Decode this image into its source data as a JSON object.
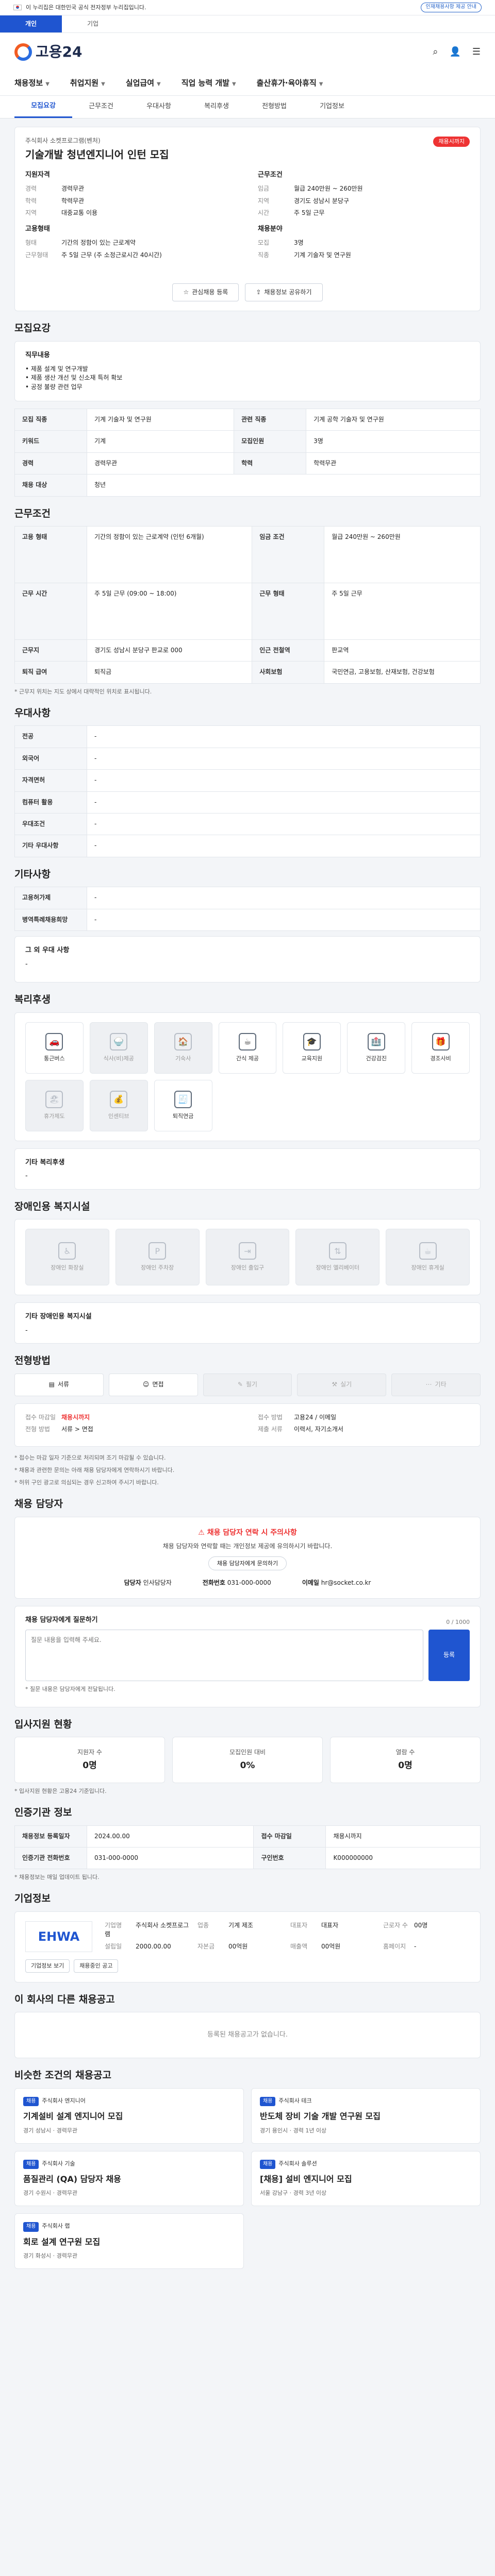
{
  "gov": {
    "text": "이 누리집은 대한민국 공식 전자정부 누리집입니다.",
    "chip": "인재채용사항 제공 안내"
  },
  "tabs": [
    "개인",
    "기업"
  ],
  "logo": "고용24",
  "gnb": [
    "채용정보",
    "취업지원",
    "실업급여",
    "직업 능력 개발",
    "출산휴가·육아휴직"
  ],
  "subtabs": [
    "모집요강",
    "근무조건",
    "우대사항",
    "복리후생",
    "전형방법",
    "기업정보"
  ],
  "job": {
    "company": "주식회사 소켓프로그램(벤처)",
    "title": "기술개발 청년엔지니어 인턴 모집",
    "dday": "채용시까지",
    "left_h": "지원자격",
    "right_h": "근무조건",
    "left": [
      [
        "경력",
        "경력무관"
      ],
      [
        "학력",
        "학력무관"
      ],
      [
        "지역",
        "대중교통 이용"
      ]
    ],
    "right": [
      [
        "임금",
        "월급 240만원 ~ 260만원"
      ],
      [
        "지역",
        "경기도 성남시 분당구"
      ],
      [
        "시간",
        "주 5일 근무"
      ]
    ],
    "left2_h": "고용형태",
    "right2_h": "채용분야",
    "left2": [
      [
        "형태",
        "기간의 정함이 있는 근로계약"
      ],
      [
        "근무형태",
        "주 5일 근무 (주 소정근로시간 40시간)"
      ]
    ],
    "right2": [
      [
        "모집",
        "3명"
      ],
      [
        "직종",
        "기계 기술자 및 연구원"
      ]
    ],
    "btn_save": "관심채용 등록",
    "btn_share": "채용정보 공유하기"
  },
  "recruit": {
    "title": "모집요강",
    "desc_h": "직무내용",
    "desc": "• 제품 설계 및 연구개발\n• 제품 생산 개선 및 신소재 특허 확보\n• 공정 불량 관련 업무",
    "rows": [
      [
        "모집 직종",
        "기계 기술자 및 연구원"
      ],
      [
        "관련 직종",
        "기계 공학 기술자 및 연구원"
      ],
      [
        "키워드",
        "기계"
      ],
      [
        "모집인원",
        "3명"
      ],
      [
        "경력",
        "경력무관"
      ],
      [
        "학력",
        "학력무관"
      ]
    ],
    "extra": [
      "채용 대상",
      "청년"
    ]
  },
  "work": {
    "title": "근무조건",
    "rows": [
      [
        "고용 형태",
        "기간의 정함이 있는 근로계약 (인턴 6개월)",
        "임금 조건",
        "월급 240만원 ~ 260만원"
      ],
      [
        "근무 시간",
        "주 5일 근무 (09:00 ~ 18:00)",
        "근무 형태",
        "주 5일 근무"
      ],
      [
        "근무지",
        "경기도 성남시 분당구 판교로 000",
        "인근 전철역",
        "판교역"
      ],
      [
        "퇴직 급여",
        "퇴직금",
        "사회보험",
        "국민연금, 고용보험, 산재보험, 건강보험"
      ]
    ],
    "note": "* 근무지 위치는 지도 상에서 대략적인 위치로 표시됩니다."
  },
  "pref": {
    "title": "우대사항",
    "rows": [
      [
        "전공",
        "-"
      ],
      [
        "외국어",
        "-"
      ],
      [
        "자격면허",
        "-"
      ],
      [
        "컴퓨터 활용",
        "-"
      ],
      [
        "우대조건",
        "-"
      ],
      [
        "기타 우대사항",
        "-"
      ]
    ]
  },
  "other": {
    "title": "기타사항",
    "rows": [
      [
        "고용허가제",
        "-"
      ],
      [
        "병역특례채용희망",
        "-"
      ]
    ],
    "detail_h": "그 외 우대 사항",
    "detail": "-"
  },
  "welfare": {
    "title": "복리후생",
    "items": [
      [
        "🚗",
        "통근버스"
      ],
      [
        "🍚",
        "식사(비)제공"
      ],
      [
        "🏠",
        "기숙사"
      ],
      [
        "☕",
        "간식 제공"
      ],
      [
        "🎓",
        "교육지원"
      ],
      [
        "🏥",
        "건강검진"
      ],
      [
        "🎁",
        "경조사비"
      ],
      [
        "🏖",
        "휴가제도"
      ],
      [
        "💰",
        "인센티브"
      ],
      [
        "🧾",
        "퇴직연금"
      ]
    ],
    "other_h": "기타 복리후생",
    "other": "-"
  },
  "disabled": {
    "title": "장애인용 복지시설",
    "items": [
      "장애인 화장실",
      "장애인 주차장",
      "장애인 출입구",
      "장애인 엘리베이터",
      "장애인 휴게실"
    ],
    "other_h": "기타 장애인용 복지시설",
    "other": "-"
  },
  "apply": {
    "title": "전형방법",
    "methods": [
      "서류",
      "면접",
      "필기",
      "실기",
      "기타"
    ],
    "left": [
      [
        "접수 마감일",
        "채용시까지"
      ],
      [
        "전형 방법",
        "서류 > 면접"
      ]
    ],
    "right": [
      [
        "접수 방법",
        "고용24 / 이메일"
      ],
      [
        "제출 서류",
        "이력서, 자기소개서"
      ]
    ],
    "notes": [
      "* 접수는 마감 일자 기준으로 처리되며 조기 마감될 수 있습니다.",
      "* 채용과 관련한 문의는 아래 채용 담당자에게 연락하시기 바랍니다.",
      "* 허위 구인 광고로 의심되는 경우 신고하여 주시기 바랍니다."
    ]
  },
  "contact": {
    "title": "채용 담당자",
    "warn": "채용 담당자 연락 시 주의사항",
    "text": "채용 담당자와 연락할 때는 개인정보 제공에 유의하시기 바랍니다.",
    "pill": "채용 담당자에게 문의하기",
    "labels": [
      "담당자",
      "전화번호",
      "이메일"
    ],
    "values": [
      "인사담당자",
      "031-000-0000",
      "hr@socket.co.kr"
    ]
  },
  "inquiry": {
    "title": "채용 담당자에게 질문하기",
    "placeholder": "질문 내용을 입력해 주세요.",
    "btn": "등록",
    "counter": "0 / 1000",
    "notes": [
      "* 질문 내용은 담당자에게 전달됩니다."
    ]
  },
  "applicants": {
    "title": "입사지원 현황",
    "stats": [
      [
        "지원자 수",
        "0명"
      ],
      [
        "모집인원 대비",
        "0%"
      ],
      [
        "열람 수",
        "0명"
      ]
    ],
    "note": "* 입사지원 현황은 고용24 기준입니다."
  },
  "reg": {
    "title": "인증기관 정보",
    "rows": [
      [
        "채용정보 등록일자",
        "2024.00.00",
        "접수 마감일",
        "채용시까지"
      ],
      [
        "인증기관 전화번호",
        "031-000-0000",
        "구인번호",
        "K000000000"
      ]
    ],
    "note": "* 채용정보는 매일 업데이트 됩니다."
  },
  "company": {
    "title": "기업정보",
    "logo": "EHWA",
    "rows": [
      [
        "기업명",
        "주식회사 소켓프로그램"
      ],
      [
        "업종",
        "기계 제조"
      ],
      [
        "대표자",
        "대표자"
      ],
      [
        "근로자 수",
        "00명"
      ],
      [
        "설립일",
        "2000.00.00"
      ],
      [
        "자본금",
        "00억원"
      ],
      [
        "매출액",
        "00억원"
      ],
      [
        "홈페이지",
        "-"
      ]
    ],
    "btns": [
      "기업정보 보기",
      "채용중인 공고"
    ]
  },
  "similar": {
    "title": "이 회사의 다른 채용공고",
    "empty": "등록된 채용공고가 없습니다."
  },
  "recommend": {
    "title": "비슷한 조건의 채용공고",
    "tiles": [
      {
        "co": "주식회사 엔지니어",
        "tt": "기계설비 설계 엔지니어 모집",
        "mt": "경기 성남시 · 경력무관"
      },
      {
        "co": "주식회사 테크",
        "tt": "반도체 장비 기술 개발 연구원 모집",
        "mt": "경기 용인시 · 경력 1년 이상"
      },
      {
        "co": "주식회사 기술",
        "tt": "품질관리 (QA) 담당자 채용",
        "mt": "경기 수원시 · 경력무관"
      },
      {
        "co": "주식회사 솔루션",
        "tt": "[채용] 설비 엔지니어 모집",
        "mt": "서울 강남구 · 경력 3년 이상"
      },
      {
        "co": "주식회사 랩",
        "tt": "회로 설계 연구원 모집",
        "mt": "경기 화성시 · 경력무관"
      }
    ]
  }
}
